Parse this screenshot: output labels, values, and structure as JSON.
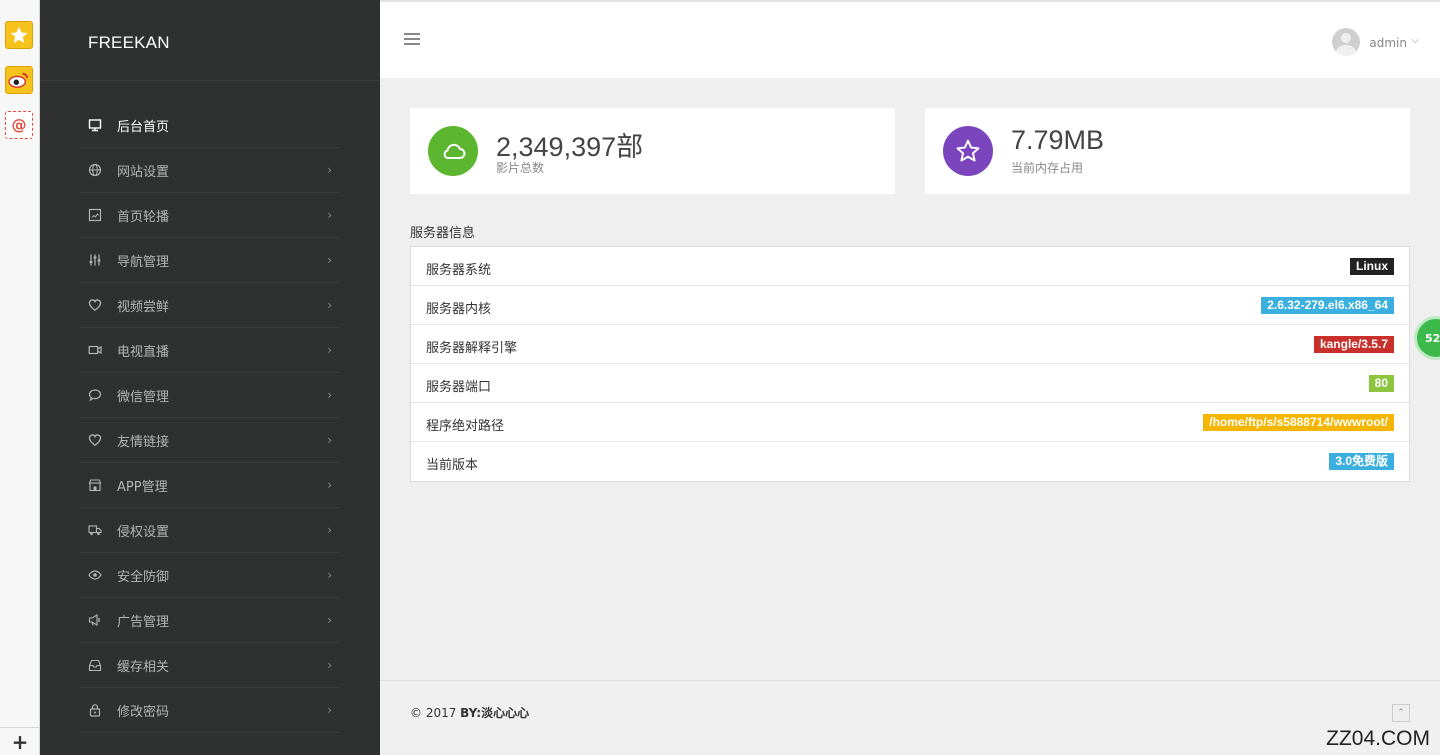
{
  "extensions": {
    "star_icon": "star-icon",
    "weibo_icon": "weibo-icon",
    "mail_glyph": "@",
    "add_glyph": "+"
  },
  "sidebar": {
    "brand": "FREEKAN",
    "items": [
      {
        "label": "后台首页",
        "icon": "monitor-icon",
        "active": true
      },
      {
        "label": "网站设置",
        "icon": "globe-icon"
      },
      {
        "label": "首页轮播",
        "icon": "image-icon"
      },
      {
        "label": "导航管理",
        "icon": "sliders-icon"
      },
      {
        "label": "视频尝鲜",
        "icon": "heart-icon"
      },
      {
        "label": "电视直播",
        "icon": "video-icon"
      },
      {
        "label": "微信管理",
        "icon": "chat-icon"
      },
      {
        "label": "友情链接",
        "icon": "heart-icon"
      },
      {
        "label": "APP管理",
        "icon": "store-icon"
      },
      {
        "label": "侵权设置",
        "icon": "truck-icon"
      },
      {
        "label": "安全防御",
        "icon": "eye-icon"
      },
      {
        "label": "广告管理",
        "icon": "megaphone-icon"
      },
      {
        "label": "缓存相关",
        "icon": "inbox-icon"
      },
      {
        "label": "修改密码",
        "icon": "lock-icon"
      }
    ],
    "chevron": "›"
  },
  "header": {
    "user_name": "admin",
    "user_chevron": "⌵"
  },
  "stats": {
    "movies": {
      "value": "2,349,397部",
      "label": "影片总数",
      "color": "#5cb630"
    },
    "memory": {
      "value": "7.79MB",
      "label": "当前内存占用",
      "color": "#7b45bd"
    }
  },
  "server": {
    "title": "服务器信息",
    "rows": [
      {
        "label": "服务器系统",
        "value": "Linux",
        "color": "#222222"
      },
      {
        "label": "服务器内核",
        "value": "2.6.32-279.el6.x86_64",
        "color": "#3bb0e0"
      },
      {
        "label": "服务器解释引擎",
        "value": "kangle/3.5.7",
        "color": "#c9302c"
      },
      {
        "label": "服务器端口",
        "value": "80",
        "color": "#8cc63e"
      },
      {
        "label": "程序绝对路径",
        "value": "/home/ftp/s/s5888714/wwwroot/",
        "color": "#f6b600"
      },
      {
        "label": "当前版本",
        "value": "3.0免费版",
        "color": "#3bb0e0"
      }
    ]
  },
  "footer": {
    "copyright": "© 2017 ",
    "by_label": "BY:淡心心心",
    "back_top": "⌃"
  },
  "overlay": {
    "watermark": "ZZ04.COM",
    "floating_ball": "52"
  }
}
